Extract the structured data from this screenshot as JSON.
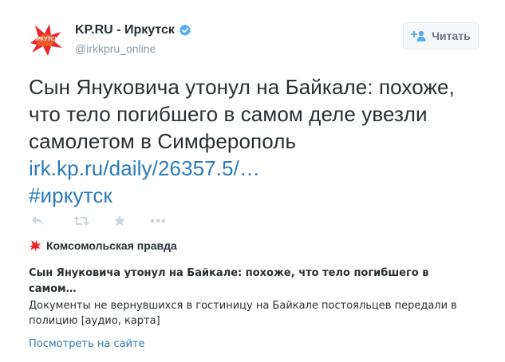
{
  "author": {
    "name": "KP.RU - Иркутск",
    "handle": "@irkkpru_online",
    "avatar_icon": "kp-irkutsk-logo-icon",
    "verified_icon": "verified-badge-icon"
  },
  "follow_button": {
    "label": "Читать",
    "icon": "add-user-icon"
  },
  "tweet": {
    "text": "Сын Януковича утонул на Байкале: похоже, что тело погибшего в самом деле увезли самолетом в Симферополь",
    "link": "irk.kp.ru/daily/26357.5/…",
    "hashtag": "#иркутск"
  },
  "actions": [
    {
      "name": "reply-icon"
    },
    {
      "name": "retweet-icon"
    },
    {
      "name": "favorite-icon"
    },
    {
      "name": "more-icon"
    }
  ],
  "card": {
    "source_name": "Комсомольская правда",
    "source_icon": "kp-logo-icon",
    "title": "Сын Януковича утонул на Байкале: похоже, что тело погибшего в самом…",
    "description": "Документы не вернувшихся в гостиницу на Байкале постояльцев передали в полицию [аудио, карта]",
    "view_link": "Посмотреть на сайте"
  },
  "colors": {
    "link": "#2b7bb9",
    "text": "#292f33",
    "muted": "#8899a6",
    "logo_red": "#e8262b",
    "verified": "#55acee",
    "icon": "#ccd6dd"
  }
}
